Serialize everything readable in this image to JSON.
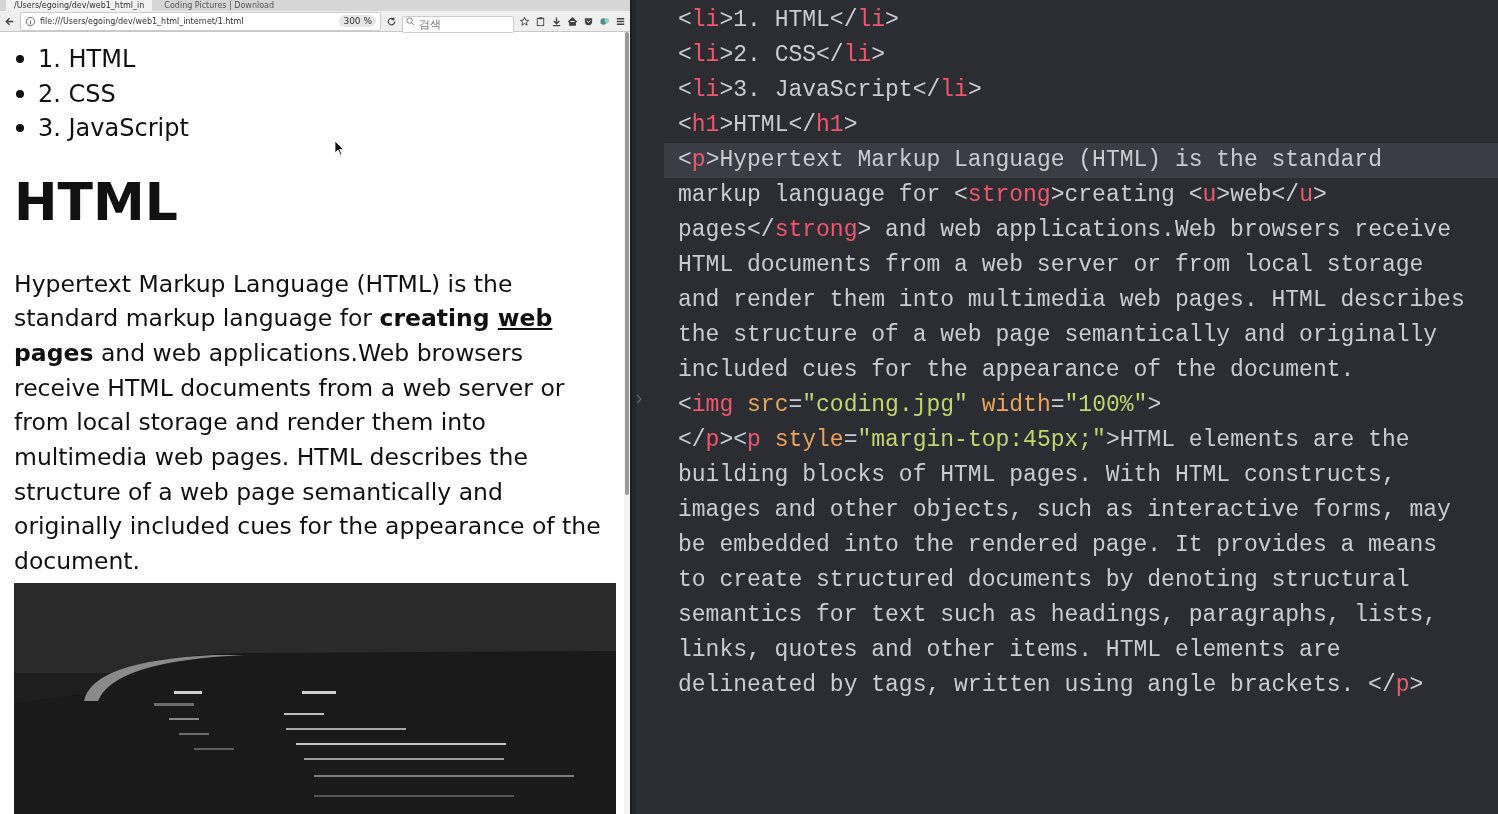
{
  "browser": {
    "tabs": [
      {
        "label": "/Users/egoing/dev/web1_html_in",
        "selected": true
      },
      {
        "label": "Coding Pictures | Download",
        "selected": false
      }
    ],
    "address": "file:///Users/egoing/dev/web1_html_internet/1.html",
    "zoom": "300 %",
    "search": {
      "placeholder": "검색"
    }
  },
  "page": {
    "list": [
      "1. HTML",
      "2. CSS",
      "3. JavaScript"
    ],
    "heading": "HTML",
    "paragraph": [
      {
        "text": "Hypertext Markup Language (HTML) is the standard markup language for ",
        "bold": false,
        "underline": false
      },
      {
        "text": "creating ",
        "bold": true,
        "underline": false
      },
      {
        "text": "web",
        "bold": true,
        "underline": true
      },
      {
        "text": " pages",
        "bold": true,
        "underline": false
      },
      {
        "text": " and web applications.Web browsers receive HTML documents from a web server or from local storage and render them into multimedia web pages. HTML describes the structure of a web page semantically and originally included cues for the appearance of the document.",
        "bold": false,
        "underline": false
      }
    ]
  },
  "editor": {
    "lines": [
      {
        "current": false,
        "tokens": [
          {
            "kind": "punct",
            "text": "<"
          },
          {
            "kind": "tag",
            "text": "li"
          },
          {
            "kind": "text",
            "text": ">1. HTML</"
          },
          {
            "kind": "tag",
            "text": "li"
          },
          {
            "kind": "punct",
            "text": ">"
          }
        ]
      },
      {
        "current": false,
        "tokens": [
          {
            "kind": "punct",
            "text": "<"
          },
          {
            "kind": "tag",
            "text": "li"
          },
          {
            "kind": "text",
            "text": ">2. CSS</"
          },
          {
            "kind": "tag",
            "text": "li"
          },
          {
            "kind": "punct",
            "text": ">"
          }
        ]
      },
      {
        "current": false,
        "tokens": [
          {
            "kind": "punct",
            "text": "<"
          },
          {
            "kind": "tag",
            "text": "li"
          },
          {
            "kind": "text",
            "text": ">3. JavaScript</"
          },
          {
            "kind": "tag",
            "text": "li"
          },
          {
            "kind": "punct",
            "text": ">"
          }
        ]
      },
      {
        "current": false,
        "tokens": [
          {
            "kind": "punct",
            "text": "<"
          },
          {
            "kind": "tag",
            "text": "h1"
          },
          {
            "kind": "text",
            "text": ">HTML</"
          },
          {
            "kind": "tag",
            "text": "h1"
          },
          {
            "kind": "punct",
            "text": ">"
          }
        ]
      },
      {
        "current": true,
        "tokens": [
          {
            "kind": "punct",
            "text": "<"
          },
          {
            "kind": "tag",
            "text": "p"
          },
          {
            "kind": "text",
            "text": ">Hypertext Markup Language (HTML) is the standard"
          }
        ]
      },
      {
        "current": false,
        "tokens": [
          {
            "kind": "text",
            "text": "markup language for <"
          },
          {
            "kind": "tag",
            "text": "strong"
          },
          {
            "kind": "text",
            "text": ">creating <"
          },
          {
            "kind": "tag",
            "text": "u"
          },
          {
            "kind": "text",
            "text": ">web</"
          },
          {
            "kind": "tag",
            "text": "u"
          },
          {
            "kind": "punct",
            "text": ">"
          }
        ]
      },
      {
        "current": false,
        "tokens": [
          {
            "kind": "text",
            "text": "pages</"
          },
          {
            "kind": "tag",
            "text": "strong"
          },
          {
            "kind": "text",
            "text": "> and web applications.Web browsers receive"
          }
        ]
      },
      {
        "current": false,
        "tokens": [
          {
            "kind": "text",
            "text": "HTML documents from a web server or from local storage"
          }
        ]
      },
      {
        "current": false,
        "tokens": [
          {
            "kind": "text",
            "text": "and render them into multimedia web pages. HTML describes"
          }
        ]
      },
      {
        "current": false,
        "tokens": [
          {
            "kind": "text",
            "text": "the structure of a web page semantically and originally"
          }
        ]
      },
      {
        "current": false,
        "tokens": [
          {
            "kind": "text",
            "text": "included cues for the appearance of the document."
          }
        ]
      },
      {
        "current": false,
        "tokens": [
          {
            "kind": "punct",
            "text": "<"
          },
          {
            "kind": "tag",
            "text": "img"
          },
          {
            "kind": "attr",
            "text": " src"
          },
          {
            "kind": "punct",
            "text": "="
          },
          {
            "kind": "string",
            "text": "\"coding.jpg\""
          },
          {
            "kind": "attr",
            "text": " width"
          },
          {
            "kind": "punct",
            "text": "="
          },
          {
            "kind": "string",
            "text": "\"100%\""
          },
          {
            "kind": "punct",
            "text": ">"
          }
        ]
      },
      {
        "current": false,
        "tokens": [
          {
            "kind": "punct",
            "text": "</"
          },
          {
            "kind": "tag",
            "text": "p"
          },
          {
            "kind": "punct",
            "text": "><"
          },
          {
            "kind": "tag",
            "text": "p"
          },
          {
            "kind": "attr",
            "text": " style"
          },
          {
            "kind": "punct",
            "text": "="
          },
          {
            "kind": "string",
            "text": "\"margin-top:45px;\""
          },
          {
            "kind": "text",
            "text": ">HTML elements are the"
          }
        ]
      },
      {
        "current": false,
        "tokens": [
          {
            "kind": "text",
            "text": "building blocks of HTML pages. With HTML constructs,"
          }
        ]
      },
      {
        "current": false,
        "tokens": [
          {
            "kind": "text",
            "text": "images and other objects, such as interactive forms, may"
          }
        ]
      },
      {
        "current": false,
        "tokens": [
          {
            "kind": "text",
            "text": "be embedded into the rendered page. It provides a means"
          }
        ]
      },
      {
        "current": false,
        "tokens": [
          {
            "kind": "text",
            "text": "to create structured documents by denoting structural"
          }
        ]
      },
      {
        "current": false,
        "tokens": [
          {
            "kind": "text",
            "text": "semantics for text such as headings, paragraphs, lists,"
          }
        ]
      },
      {
        "current": false,
        "tokens": [
          {
            "kind": "text",
            "text": "links, quotes and other items. HTML elements are"
          }
        ]
      },
      {
        "current": false,
        "tokens": [
          {
            "kind": "text",
            "text": "delineated by tags, written using angle brackets. </"
          },
          {
            "kind": "tag",
            "text": "p"
          },
          {
            "kind": "punct",
            "text": ">"
          }
        ]
      }
    ]
  }
}
